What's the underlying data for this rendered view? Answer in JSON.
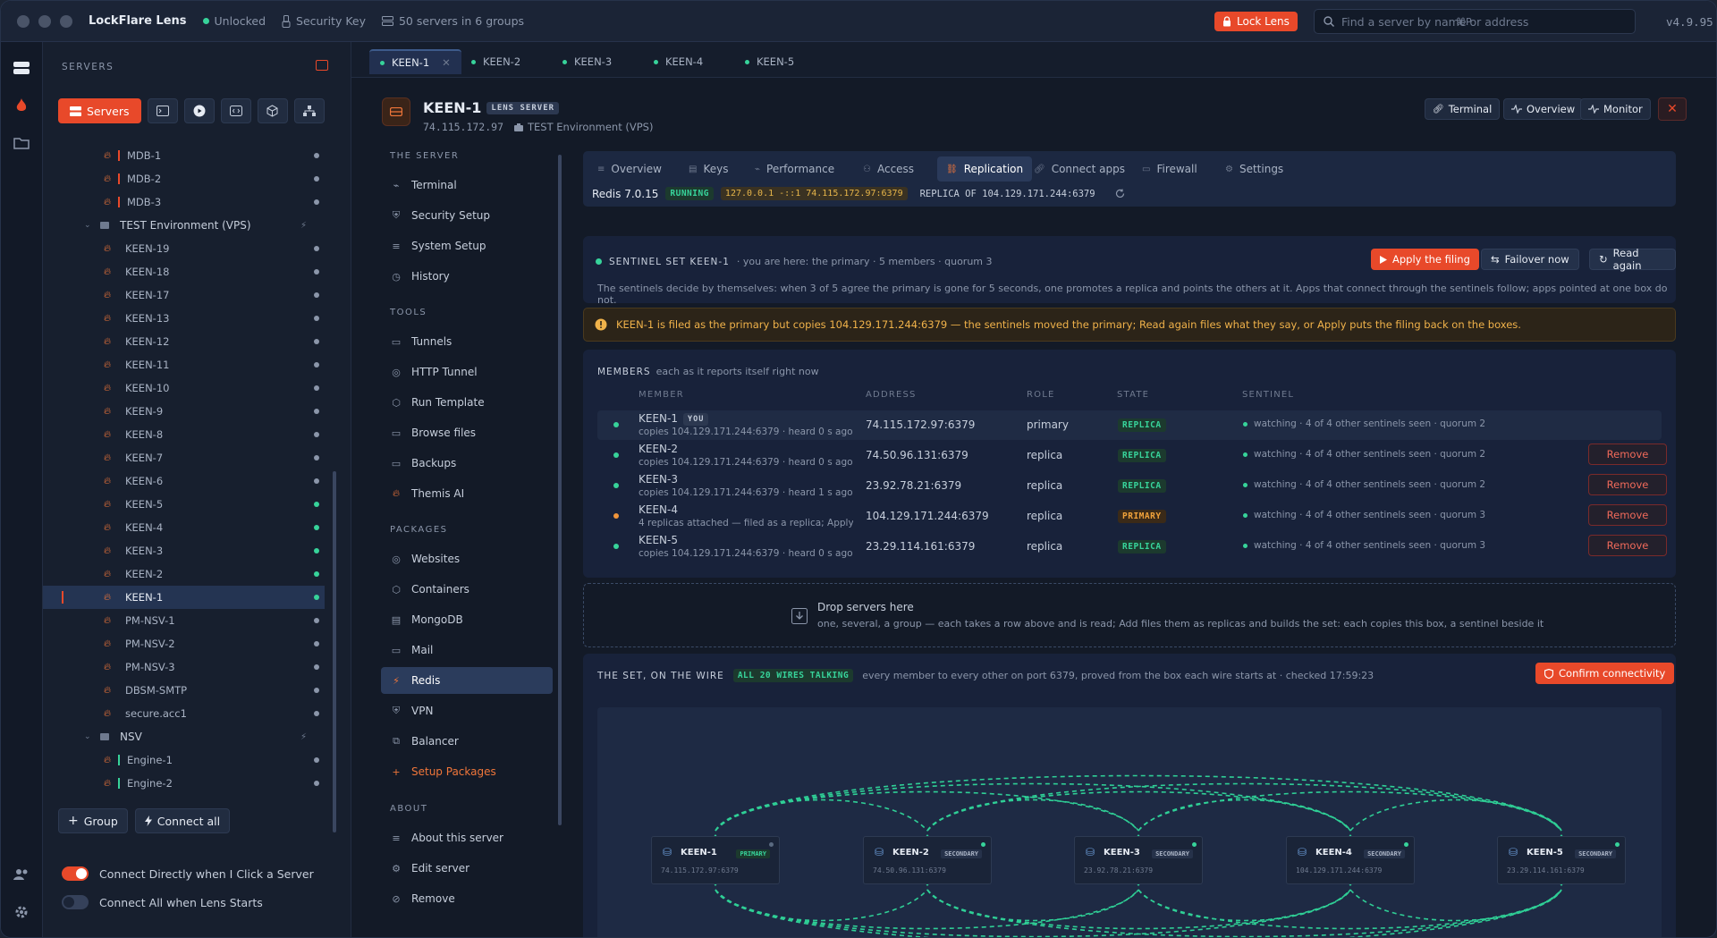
{
  "titlebar": {
    "app": "LockFlare Lens",
    "unlocked": "Unlocked",
    "security_key": "Security Key",
    "servers_count": "50 servers in 6 groups",
    "lock_button": "Lock Lens",
    "search_placeholder": "Find a server by name or address",
    "search_shortcut": "⌘P",
    "version": "v4.9.95"
  },
  "sidebar": {
    "heading": "SERVERS",
    "servers_tab": "Servers",
    "tree": [
      {
        "label": "MDB-1",
        "type": "server",
        "bar": "#e8492a",
        "status": "grey"
      },
      {
        "label": "MDB-2",
        "type": "server",
        "bar": "#e8492a",
        "status": "grey"
      },
      {
        "label": "MDB-3",
        "type": "server",
        "bar": "#e8492a",
        "status": "grey"
      },
      {
        "label": "TEST Environment (VPS)",
        "type": "group"
      },
      {
        "label": "KEEN-19",
        "type": "server",
        "status": "grey"
      },
      {
        "label": "KEEN-18",
        "type": "server",
        "status": "grey"
      },
      {
        "label": "KEEN-17",
        "type": "server",
        "status": "grey"
      },
      {
        "label": "KEEN-13",
        "type": "server",
        "status": "grey"
      },
      {
        "label": "KEEN-12",
        "type": "server",
        "status": "grey"
      },
      {
        "label": "KEEN-11",
        "type": "server",
        "status": "grey"
      },
      {
        "label": "KEEN-10",
        "type": "server",
        "status": "grey"
      },
      {
        "label": "KEEN-9",
        "type": "server",
        "status": "grey"
      },
      {
        "label": "KEEN-8",
        "type": "server",
        "status": "grey"
      },
      {
        "label": "KEEN-7",
        "type": "server",
        "status": "grey"
      },
      {
        "label": "KEEN-6",
        "type": "server",
        "status": "grey"
      },
      {
        "label": "KEEN-5",
        "type": "server",
        "status": "green"
      },
      {
        "label": "KEEN-4",
        "type": "server",
        "status": "green"
      },
      {
        "label": "KEEN-3",
        "type": "server",
        "status": "green"
      },
      {
        "label": "KEEN-2",
        "type": "server",
        "status": "green"
      },
      {
        "label": "KEEN-1",
        "type": "server",
        "status": "green",
        "selected": true
      },
      {
        "label": "PM-NSV-1",
        "type": "server",
        "status": "grey"
      },
      {
        "label": "PM-NSV-2",
        "type": "server",
        "status": "grey"
      },
      {
        "label": "PM-NSV-3",
        "type": "server",
        "status": "grey"
      },
      {
        "label": "DBSM-SMTP",
        "type": "server",
        "status": "grey"
      },
      {
        "label": "secure.acc1",
        "type": "server",
        "status": "grey"
      },
      {
        "label": "NSV",
        "type": "group"
      },
      {
        "label": "Engine-1",
        "type": "server",
        "bar": "#37d39a",
        "status": "grey"
      },
      {
        "label": "Engine-2",
        "type": "server",
        "bar": "#37d39a",
        "status": "grey"
      }
    ],
    "group_button": "Group",
    "connect_all_button": "Connect all",
    "toggle_direct": "Connect Directly when I Click a Server",
    "toggle_all": "Connect All when Lens Starts"
  },
  "tabs": [
    "KEEN-1",
    "KEEN-2",
    "KEEN-3",
    "KEEN-4",
    "KEEN-5"
  ],
  "server": {
    "name": "KEEN-1",
    "badge": "LENS SERVER",
    "ip": "74.115.172.97",
    "group": "TEST Environment (VPS)",
    "btn_terminal": "Terminal",
    "btn_overview": "Overview",
    "btn_monitor": "Monitor"
  },
  "nav": {
    "section_server": "THE SERVER",
    "section_tools": "TOOLS",
    "section_packages": "PACKAGES",
    "section_about": "ABOUT",
    "server_items": [
      "Terminal",
      "Security Setup",
      "System Setup",
      "History"
    ],
    "tool_items": [
      "Tunnels",
      "HTTP Tunnel",
      "Run Template",
      "Browse files",
      "Backups",
      "Themis AI"
    ],
    "package_items": [
      "Websites",
      "Containers",
      "MongoDB",
      "Mail",
      "Redis",
      "VPN",
      "Balancer",
      "Setup Packages"
    ],
    "about_items": [
      "About this server",
      "Edit server",
      "Remove"
    ]
  },
  "subtabs": [
    "Overview",
    "Keys",
    "Performance",
    "Access",
    "Replication",
    "Connect apps",
    "Firewall",
    "Settings"
  ],
  "redis": {
    "version": "Redis 7.0.15",
    "state": "RUNNING",
    "bind": "127.0.0.1 -::1 74.115.172.97:6379",
    "replica_of": "REPLICA OF 104.129.171.244:6379"
  },
  "sentinel": {
    "title": "SENTINEL SET KEEN-1",
    "meta": "· you are here: the primary · 5 members · quorum 3",
    "desc": "The sentinels decide by themselves: when 3 of 5 agree the primary is gone for 5 seconds, one promotes a replica and points the others at it. Apps that connect through the sentinels follow; apps pointed at one box do not.",
    "apply_button": "Apply the filing",
    "failover_button": "Failover now",
    "read_button": "Read again"
  },
  "warning": "KEEN-1 is filed as the primary but copies 104.129.171.244:6379 — the sentinels moved the primary; Read again files what they say, or Apply puts the filing back on the boxes.",
  "members": {
    "title": "MEMBERS",
    "subtitle": "each as it reports itself right now",
    "headers": [
      "MEMBER",
      "ADDRESS",
      "ROLE",
      "STATE",
      "SENTINEL"
    ],
    "you_tag": "YOU",
    "remove_label": "Remove",
    "rows": [
      {
        "name": "KEEN-1",
        "sub": "copies 104.129.171.244:6379 · heard 0 s ago",
        "address": "74.115.172.97:6379",
        "role": "primary",
        "state": "REPLICA",
        "sentinel": "watching · 4 of 4 other sentinels seen · quorum 2",
        "dot": "green",
        "you": true
      },
      {
        "name": "KEEN-2",
        "sub": "copies 104.129.171.244:6379 · heard 0 s ago",
        "address": "74.50.96.131:6379",
        "role": "replica",
        "state": "REPLICA",
        "sentinel": "watching · 4 of 4 other sentinels seen · quorum 2",
        "dot": "green"
      },
      {
        "name": "KEEN-3",
        "sub": "copies 104.129.171.244:6379 · heard 1 s ago",
        "address": "23.92.78.21:6379",
        "role": "replica",
        "state": "REPLICA",
        "sentinel": "watching · 4 of 4 other sentinels seen · quorum 2",
        "dot": "green"
      },
      {
        "name": "KEEN-4",
        "sub": "4 replicas attached — filed as a replica; Apply ...",
        "address": "104.129.171.244:6379",
        "role": "replica",
        "state": "PRIMARY",
        "sentinel": "watching · 4 of 4 other sentinels seen · quorum 3",
        "dot": "orange"
      },
      {
        "name": "KEEN-5",
        "sub": "copies 104.129.171.244:6379 · heard 0 s ago",
        "address": "23.29.114.161:6379",
        "role": "replica",
        "state": "REPLICA",
        "sentinel": "watching · 4 of 4 other sentinels seen · quorum 3",
        "dot": "green"
      }
    ]
  },
  "drop": {
    "title": "Drop servers here",
    "desc": "one, several, a group — each takes a row above and is read; Add files them as replicas and builds the set: each copies this box, a sentinel beside it"
  },
  "wire": {
    "title": "THE SET, ON THE WIRE",
    "badge": "ALL 20 WIRES TALKING",
    "desc": "every member to every other on port 6379, proved from the box each wire starts at · checked 17:59:23",
    "confirm_button": "Confirm connectivity",
    "nodes": [
      {
        "name": "KEEN-1",
        "address": "74.115.172.97:6379",
        "role": "PRIMARY"
      },
      {
        "name": "KEEN-2",
        "address": "74.50.96.131:6379",
        "role": "SECONDARY"
      },
      {
        "name": "KEEN-3",
        "address": "23.92.78.21:6379",
        "role": "SECONDARY"
      },
      {
        "name": "KEEN-4",
        "address": "104.129.171.244:6379",
        "role": "SECONDARY"
      },
      {
        "name": "KEEN-5",
        "address": "23.29.114.161:6379",
        "role": "SECONDARY"
      }
    ]
  },
  "colors": {
    "accent": "#e8492a",
    "green": "#37d39a",
    "wire": "#2fcf96"
  }
}
